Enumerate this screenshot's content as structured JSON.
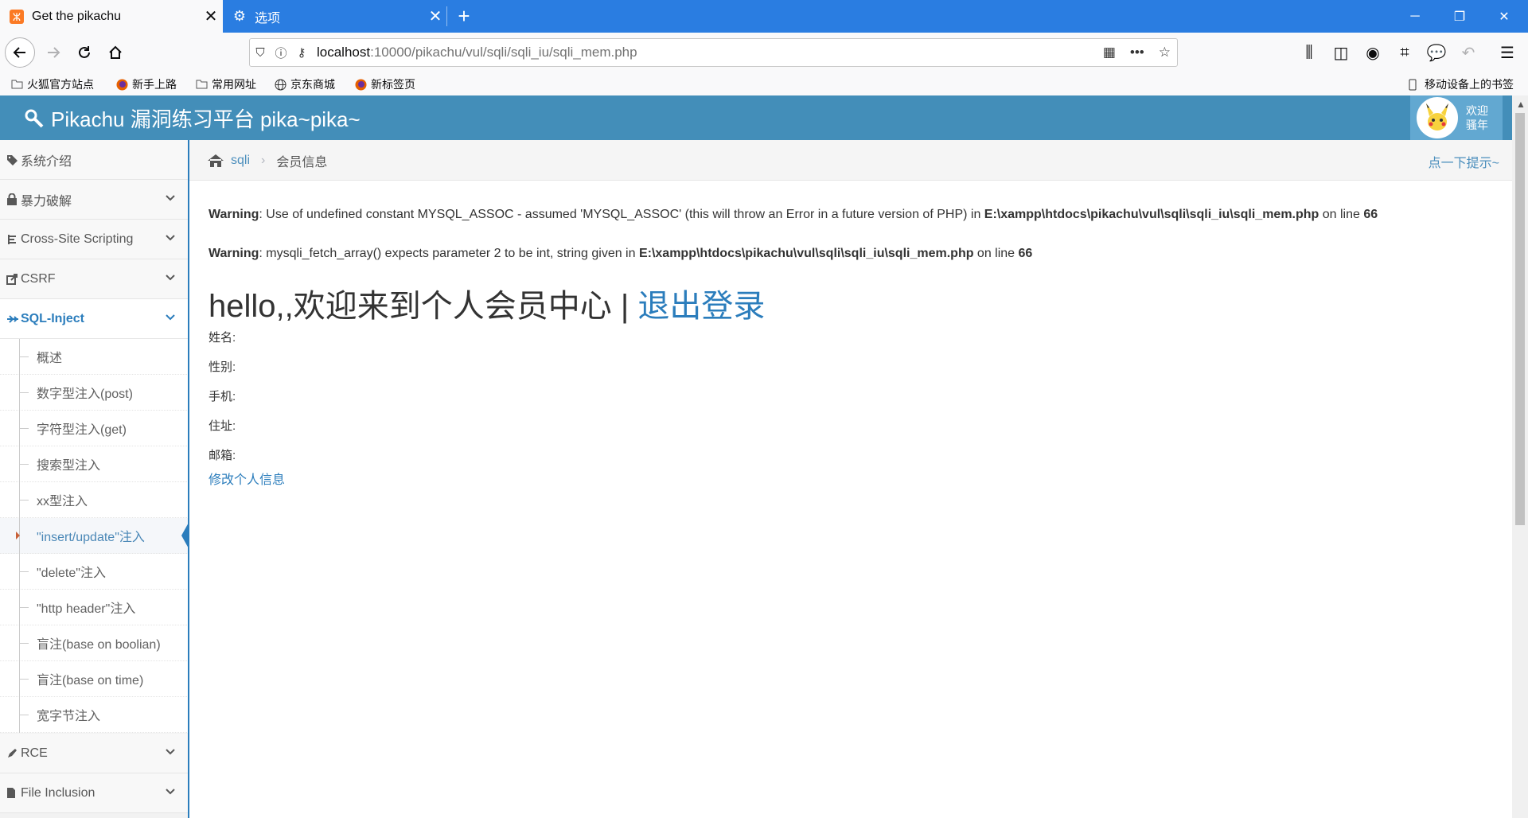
{
  "browser": {
    "tabs": [
      {
        "title": "Get the pikachu",
        "active": true
      },
      {
        "title": "选项",
        "active": false
      }
    ],
    "url_host": "localhost",
    "url_rest": ":10000/pikachu/vul/sqli/sqli_iu/sqli_mem.php",
    "bookmarks": [
      "火狐官方站点",
      "新手上路",
      "常用网址",
      "京东商城",
      "新标签页"
    ],
    "mobile_bookmarks": "移动设备上的书签"
  },
  "header": {
    "title": "Pikachu 漏洞练习平台 pika~pika~",
    "welcome_line1": "欢迎",
    "welcome_line2": "骚年"
  },
  "sidebar": {
    "items": [
      {
        "label": "系统介绍",
        "icon": "tags-icon"
      },
      {
        "label": "暴力破解",
        "icon": "lock-icon"
      },
      {
        "label": "Cross-Site Scripting",
        "icon": "xss-icon"
      },
      {
        "label": "CSRF",
        "icon": "share-icon"
      },
      {
        "label": "SQL-Inject",
        "icon": "fighter-jet-icon"
      }
    ],
    "sub_items": [
      "概述",
      "数字型注入(post)",
      "字符型注入(get)",
      "搜索型注入",
      "xx型注入",
      "\"insert/update\"注入",
      "\"delete\"注入",
      "\"http header\"注入",
      "盲注(base on boolian)",
      "盲注(base on time)",
      "宽字节注入"
    ],
    "after_items": [
      {
        "label": "RCE",
        "icon": "pencil-icon"
      },
      {
        "label": "File Inclusion",
        "icon": "file-icon"
      }
    ]
  },
  "breadcrumb": {
    "link": "sqli",
    "current": "会员信息",
    "hint": "点一下提示~"
  },
  "warnings": [
    {
      "label": "Warning",
      "text": ": Use of undefined constant MYSQL_ASSOC - assumed 'MYSQL_ASSOC' (this will throw an Error in a future version of PHP) in ",
      "file": "E:\\xampp\\htdocs\\pikachu\\vul\\sqli\\sqli_iu\\sqli_mem.php",
      "on_line": " on line ",
      "line": "66"
    },
    {
      "label": "Warning",
      "text": ": mysqli_fetch_array() expects parameter 2 to be int, string given in ",
      "file": "E:\\xampp\\htdocs\\pikachu\\vul\\sqli\\sqli_iu\\sqli_mem.php",
      "on_line": " on line ",
      "line": "66"
    }
  ],
  "main": {
    "hello": "hello,,欢迎来到个人会员中心 | ",
    "logout": "退出登录",
    "fields": [
      "姓名:",
      "性别:",
      "手机:",
      "住址:",
      "邮箱:"
    ],
    "edit_link": "修改个人信息"
  }
}
